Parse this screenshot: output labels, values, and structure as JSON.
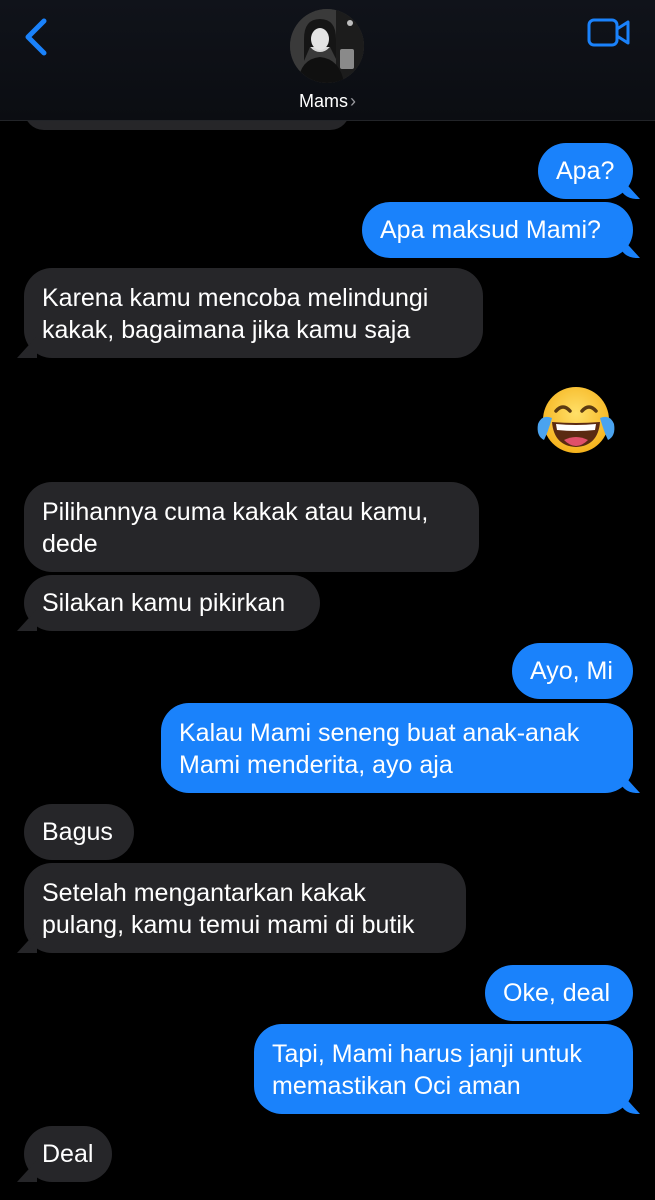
{
  "header": {
    "contact_name": "Mams",
    "chevron": "›",
    "back_icon": "chevron-left-icon",
    "video_icon": "video-camera-icon",
    "accent_color": "#1a82fb"
  },
  "colors": {
    "outgoing_bubble": "#1a82fb",
    "incoming_bubble": "#262629",
    "background": "#000000"
  },
  "messages": [
    {
      "direction": "out",
      "text": "Apa?"
    },
    {
      "direction": "out",
      "text": "Apa maksud Mami?"
    },
    {
      "direction": "in",
      "lines": [
        "Karena kamu mencoba melindungi",
        "kakak, bagaimana jika kamu saja"
      ]
    },
    {
      "direction": "out",
      "emoji": "😂",
      "emoji_name": "face-with-tears-of-joy-emoji"
    },
    {
      "direction": "in",
      "lines": [
        "Pilihannya cuma kakak atau kamu,",
        "dede"
      ]
    },
    {
      "direction": "in",
      "text": "Silakan kamu pikirkan"
    },
    {
      "direction": "out",
      "text": "Ayo, Mi"
    },
    {
      "direction": "out",
      "lines": [
        "Kalau Mami seneng buat anak-anak",
        "Mami menderita, ayo aja"
      ]
    },
    {
      "direction": "in",
      "text": "Bagus"
    },
    {
      "direction": "in",
      "lines": [
        "Setelah mengantarkan kakak",
        "pulang, kamu temui mami di butik"
      ]
    },
    {
      "direction": "out",
      "text": "Oke, deal"
    },
    {
      "direction": "out",
      "lines": [
        "Tapi, Mami harus janji untuk",
        "memastikan Oci aman"
      ]
    },
    {
      "direction": "in",
      "text": "Deal"
    }
  ]
}
